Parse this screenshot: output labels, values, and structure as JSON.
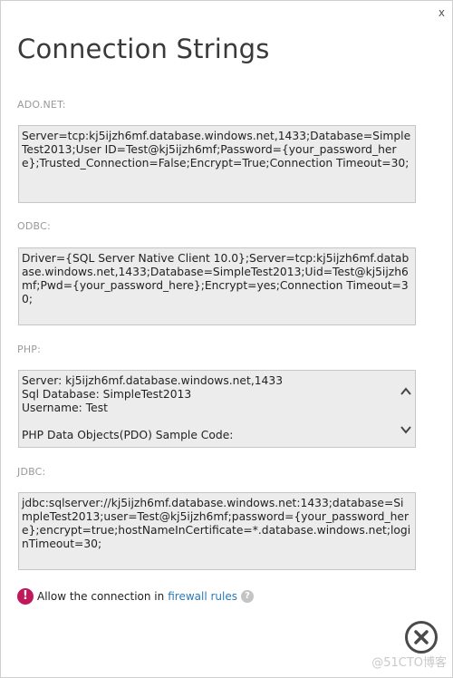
{
  "window": {
    "close_glyph": "x"
  },
  "title": "Connection Strings",
  "sections": [
    {
      "label": "ADO.NET:",
      "value": "Server=tcp:kj5ijzh6mf.database.windows.net,1433;Database=SimpleTest2013;User ID=Test@kj5ijzh6mf;Password={your_password_here};Trusted_Connection=False;Encrypt=True;Connection Timeout=30;"
    },
    {
      "label": "ODBC:",
      "value": "Driver={SQL Server Native Client 10.0};Server=tcp:kj5ijzh6mf.database.windows.net,1433;Database=SimpleTest2013;Uid=Test@kj5ijzh6mf;Pwd={your_password_here};Encrypt=yes;Connection Timeout=30;"
    },
    {
      "label": "PHP:",
      "value": "Server: kj5ijzh6mf.database.windows.net,1433\nSql Database: SimpleTest2013\nUsername: Test\n\nPHP Data Objects(PDO) Sample Code:"
    },
    {
      "label": "JDBC:",
      "value": "jdbc:sqlserver://kj5ijzh6mf.database.windows.net:1433;database=SimpleTest2013;user=Test@kj5ijzh6mf;password={your_password_here};encrypt=true;hostNameInCertificate=*.database.windows.net;loginTimeout=30;"
    }
  ],
  "footer": {
    "warning_glyph": "!",
    "text": "Allow the connection in",
    "link": "firewall rules",
    "help_glyph": "?"
  },
  "watermark": "@51CTO博客",
  "icons": {
    "warning": "exclamation-circle-icon",
    "help": "question-circle-icon",
    "close": "close-circle-icon",
    "scroll_up": "chevron-up-icon",
    "scroll_down": "chevron-down-icon"
  },
  "colors": {
    "warning": "#c0185a",
    "link": "#2a7ab8",
    "box_background": "#ececec"
  }
}
